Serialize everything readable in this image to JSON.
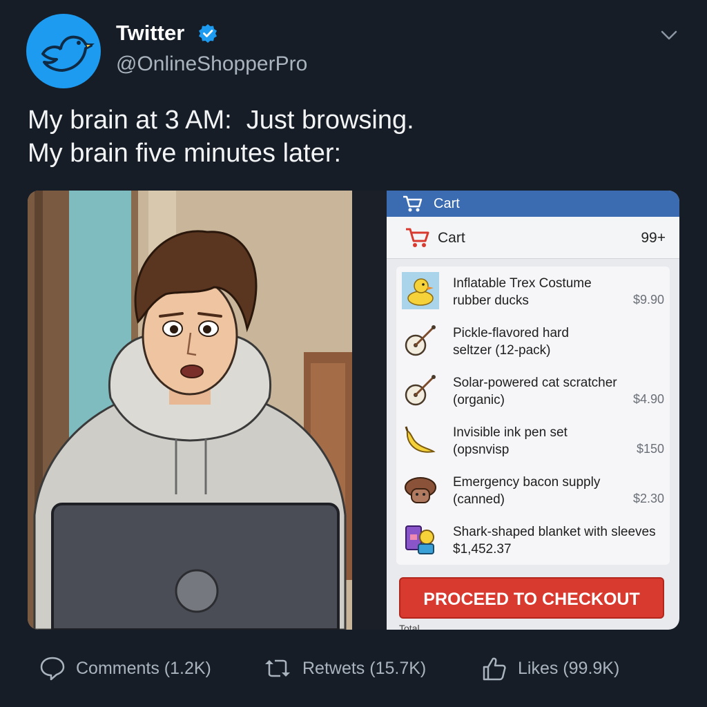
{
  "header": {
    "account_name": "Twitter",
    "handle": "@OnlineShopperPro",
    "avatar_icon": "bird-icon",
    "verified_icon": "verified-badge-icon",
    "more_icon": "chevron-down-icon"
  },
  "tweet": {
    "line1": "My brain at 3 AM:  Just browsing.",
    "line2": "My brain five minutes later:"
  },
  "media": {
    "illustration": "shocked-man-with-laptop",
    "cart": {
      "topbar_title": "Cart",
      "header_label": "Cart",
      "count": "99+",
      "items": [
        {
          "name_line1": "Inflatable Trex Costume",
          "name_line2": "rubber ducks",
          "price": "$9.90",
          "icon": "rubber-duck-icon"
        },
        {
          "name_line1": "Pickle-flavored hard",
          "name_line2": "seltzer (12-pack)",
          "price": "",
          "icon": "banjo-icon"
        },
        {
          "name_line1": "Solar-powered cat scratcher",
          "name_line2": "(organic)",
          "price": "$4.90",
          "icon": "banjo-icon"
        },
        {
          "name_line1": "Invisible ink pen set",
          "name_line2": "(opsnvisp",
          "price": "$150",
          "icon": "banana-icon"
        },
        {
          "name_line1": "Emergency bacon supply",
          "name_line2": "(canned)",
          "price": "$2.30",
          "icon": "bacon-icon"
        },
        {
          "name_line1": "Shark-shaped blanket with sleeves",
          "name_line2": "$1,452.37",
          "price": "",
          "icon": "toy-bundle-icon"
        }
      ],
      "checkout_label": "PROCEED TO CHECKOUT",
      "total_label": "Total"
    }
  },
  "actions": {
    "comments": "Comments (1.2K)",
    "retweets": "Retwets (15.7K)",
    "likes": "Likes (99.9K)"
  },
  "colors": {
    "background": "#161d27",
    "accent_blue": "#1d9bf0",
    "checkout_red": "#d93a2f"
  }
}
